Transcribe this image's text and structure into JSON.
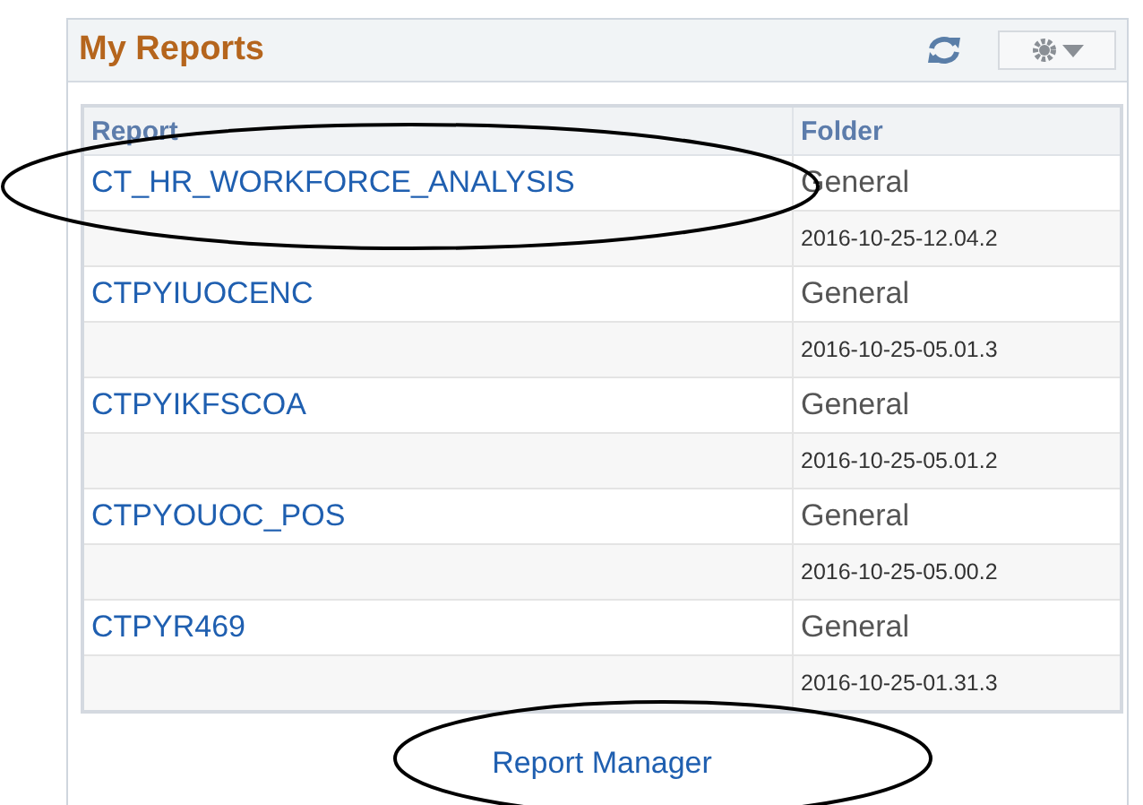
{
  "panel": {
    "title": "My Reports"
  },
  "table": {
    "columns": [
      "Report",
      "Folder"
    ],
    "rows": [
      {
        "report": "CT_HR_WORKFORCE_ANALYSIS",
        "folder": "General",
        "date": "2016-10-25-12.04.2"
      },
      {
        "report": "CTPYIUOCENC",
        "folder": "General",
        "date": "2016-10-25-05.01.3"
      },
      {
        "report": "CTPYIKFSCOA",
        "folder": "General",
        "date": "2016-10-25-05.01.2"
      },
      {
        "report": "CTPYOUOC_POS",
        "folder": "General",
        "date": "2016-10-25-05.00.2"
      },
      {
        "report": "CTPYR469",
        "folder": "General",
        "date": "2016-10-25-01.31.3"
      }
    ]
  },
  "link": "Report Manager",
  "annotations": [
    {
      "kind": "ellipse"
    },
    {
      "kind": "ellipse"
    }
  ]
}
